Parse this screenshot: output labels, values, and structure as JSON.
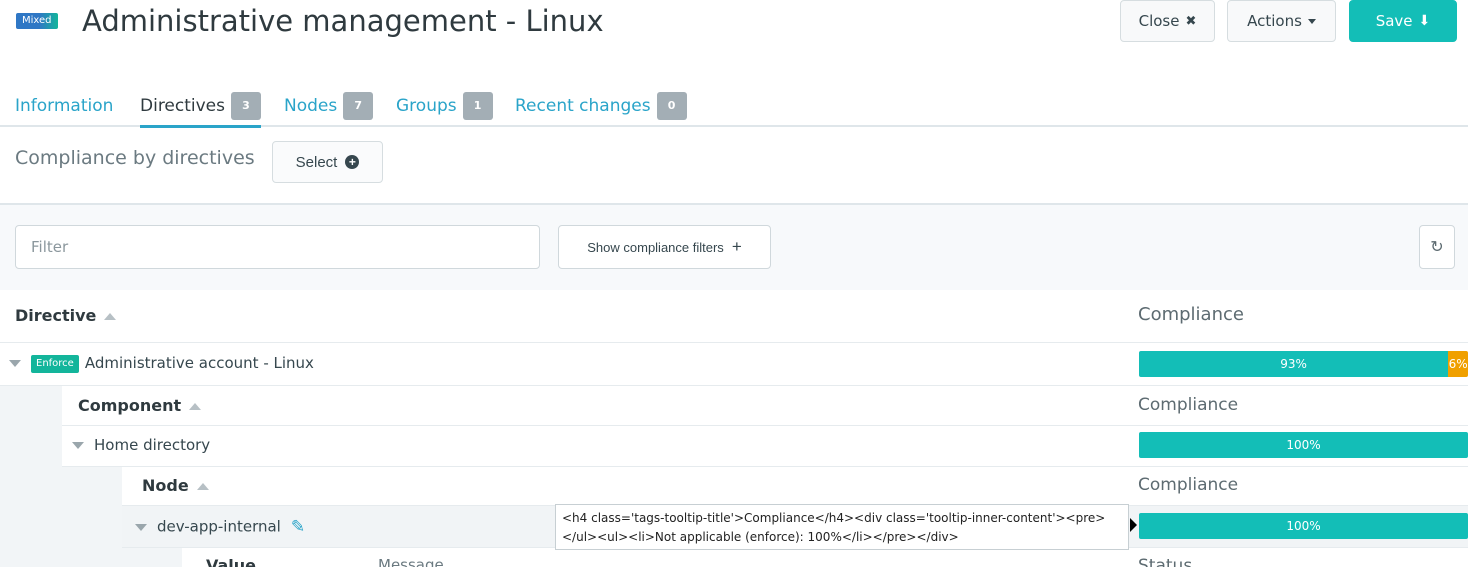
{
  "header": {
    "mode_badge": "Mixed",
    "title": "Administrative management - Linux",
    "close_label": "Close",
    "close_glyph": "✖",
    "actions_label": "Actions",
    "save_label": "Save",
    "save_glyph": "⬇"
  },
  "tabs": [
    {
      "label": "Information"
    },
    {
      "label": "Directives",
      "count": "3"
    },
    {
      "label": "Nodes",
      "count": "7"
    },
    {
      "label": "Groups",
      "count": "1"
    },
    {
      "label": "Recent changes",
      "count": "0"
    }
  ],
  "compliance": {
    "title": "Compliance by directives",
    "select_label": "Select",
    "plus_glyph": "+"
  },
  "filters": {
    "filter_placeholder": "Filter",
    "show_filters_label": "Show compliance filters",
    "show_filters_glyph": "+",
    "refresh_glyph": "↻"
  },
  "table": {
    "directive_header": "Directive",
    "compliance_header": "Compliance",
    "directive": {
      "badge": "Enforce",
      "name": "Administrative account - Linux",
      "compliance_ok": 93,
      "compliance_ok_label": "93%",
      "compliance_warn": 6,
      "compliance_warn_label": "6%"
    },
    "component_header": "Component",
    "component_compliance_header": "Compliance",
    "component": {
      "name": "Home directory",
      "compliance_label": "100%"
    },
    "node_header": "Node",
    "node_compliance_header": "Compliance",
    "node": {
      "name": "dev-app-internal",
      "compliance_label": "100%"
    },
    "value_header": "Value",
    "message_header": "Message",
    "status_header": "Status"
  },
  "tooltip": {
    "text": "<h4 class='tags-tooltip-title'>Compliance</h4><div class='tooltip-inner-content'><pre></ul><ul><li>Not applicable (enforce): 100%</li></pre></div>"
  },
  "colors": {
    "accent": "#2aa4c9",
    "success": "#13beb7",
    "warning": "#f0a000"
  }
}
